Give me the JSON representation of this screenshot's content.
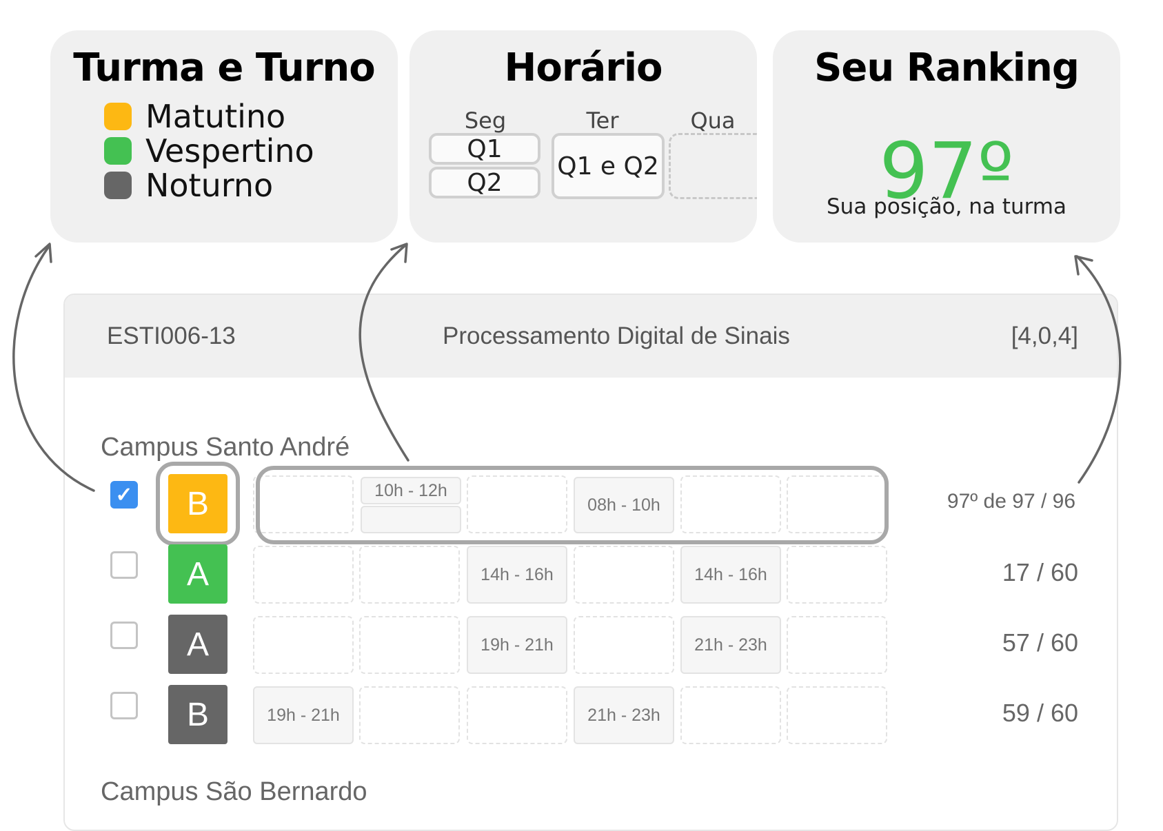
{
  "turma_card": {
    "title": "Turma e Turno",
    "legend": [
      {
        "label": "Matutino",
        "color": "#fdb813"
      },
      {
        "label": "Vespertino",
        "color": "#44c152"
      },
      {
        "label": "Noturno",
        "color": "#666666"
      }
    ]
  },
  "horario_card": {
    "title": "Horário",
    "days": [
      "Seg",
      "Ter",
      "Qua"
    ],
    "seg_slots": [
      "Q1",
      "Q2"
    ],
    "ter_slot": "Q1 e Q2"
  },
  "ranking_card": {
    "title": "Seu Ranking",
    "value": "97º",
    "caption": "Sua posição, na turma"
  },
  "course": {
    "code": "ESTI006-13",
    "name": "Processamento Digital de Sinais",
    "credits": "[4,0,4]"
  },
  "campuses": [
    {
      "name": "Campus Santo André",
      "classes": [
        {
          "selected": true,
          "letter": "B",
          "shift_color": "#fdb813",
          "times": [
            "10h - 12h",
            "08h - 10h"
          ],
          "vacancy": "97º de 97 / 96"
        },
        {
          "selected": false,
          "letter": "A",
          "shift_color": "#44c152",
          "times": [
            "14h - 16h",
            "14h - 16h"
          ],
          "vacancy": "17 / 60"
        },
        {
          "selected": false,
          "letter": "A",
          "shift_color": "#666666",
          "times": [
            "19h - 21h",
            "21h - 23h"
          ],
          "vacancy": "57 / 60"
        },
        {
          "selected": false,
          "letter": "B",
          "shift_color": "#666666",
          "times": [
            "19h - 21h",
            "21h - 23h"
          ],
          "vacancy": "59 / 60"
        }
      ]
    },
    {
      "name": "Campus São Bernardo"
    }
  ],
  "icons": {
    "checkmark": "check-icon",
    "arrows": "curved-arrow-icon"
  }
}
